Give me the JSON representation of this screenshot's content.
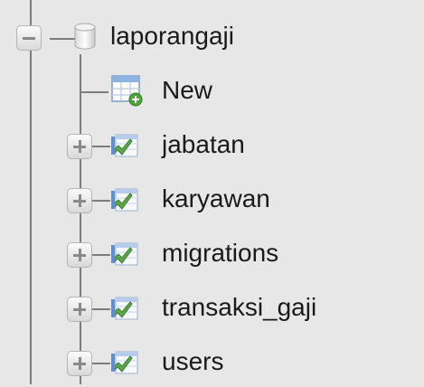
{
  "tree": {
    "database": {
      "label": "laporangaji",
      "icon": "database-icon",
      "expanded": true
    },
    "new_item": {
      "label": "New",
      "icon": "new-table-icon"
    },
    "tables": [
      {
        "label": "jabatan",
        "icon": "table-icon"
      },
      {
        "label": "karyawan",
        "icon": "table-icon"
      },
      {
        "label": "migrations",
        "icon": "table-icon"
      },
      {
        "label": "transaksi_gaji",
        "icon": "table-icon"
      },
      {
        "label": "users",
        "icon": "table-icon"
      }
    ]
  },
  "colors": {
    "background": "#e7e7e7",
    "connector": "#7d7d7d",
    "table_icon_green": "#5aa84a",
    "table_icon_blue": "#5b8fd6"
  }
}
